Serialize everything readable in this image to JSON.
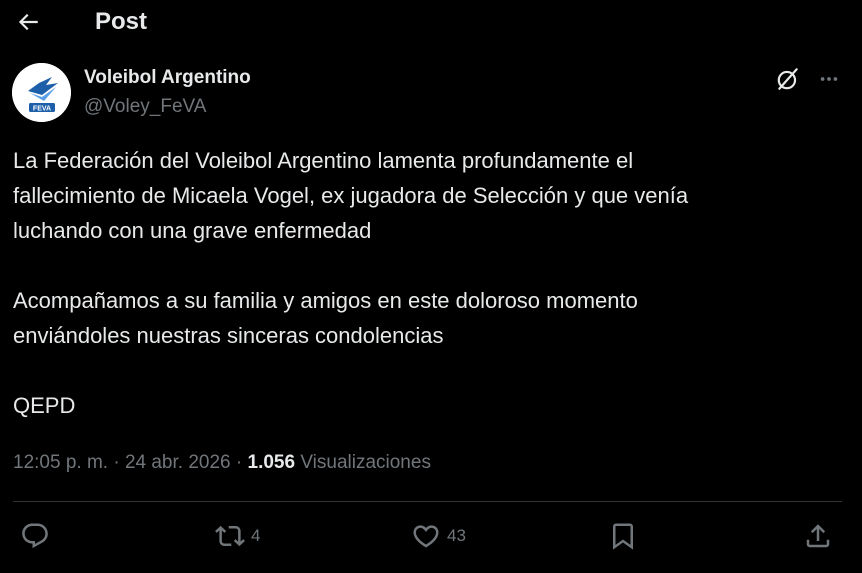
{
  "header": {
    "title": "Post",
    "back_icon": "arrow-left-icon"
  },
  "author": {
    "name": "Voleibol Argentino",
    "handle": "@Voley_FeVA",
    "avatar_text": "FEVA"
  },
  "tweet": {
    "paragraph1": [
      "La Federación del Voleibol Argentino lamenta profundamente el",
      "fallecimiento de Micaela Vogel, ex jugadora de Selección y que venía",
      "luchando con una grave enfermedad"
    ],
    "paragraph2": [
      "Acompañamos a su familia y amigos en este doloroso momento",
      "enviándoles nuestras sinceras condolencias"
    ],
    "paragraph3": "QEPD"
  },
  "meta": {
    "time": "12:05 p. m.",
    "separator": "·",
    "date": "24 abr. 2026",
    "views_count": "1.056",
    "views_label": "Visualizaciones"
  },
  "actions": {
    "reply_count": "",
    "retweet_count": "4",
    "like_count": "43"
  },
  "colors": {
    "background": "#000000",
    "text_primary": "#e7e9ea",
    "text_secondary": "#71767b",
    "divider": "#2f3336",
    "avatar_brand": "#1d5fa8"
  }
}
